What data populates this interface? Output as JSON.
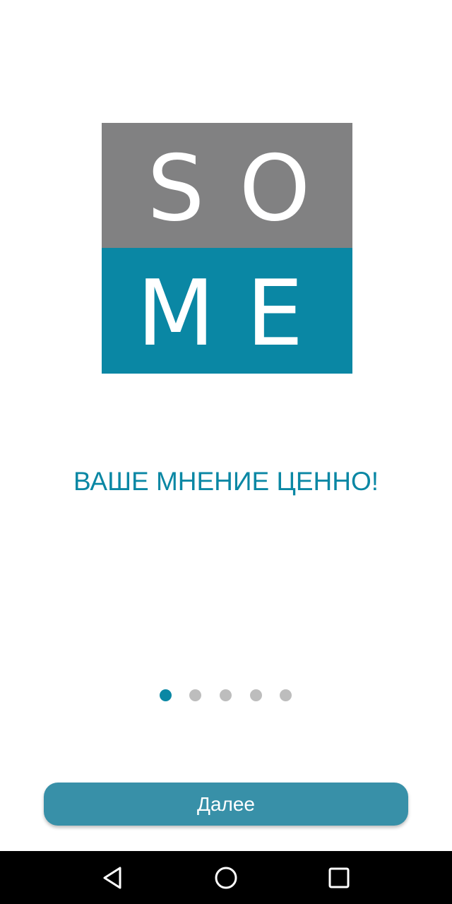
{
  "logo": {
    "letters": [
      "S",
      "O",
      "M",
      "E"
    ],
    "colors": {
      "top": "#818182",
      "bottom": "#0a87a4"
    }
  },
  "onboarding": {
    "tagline": "ВАШЕ МНЕНИЕ ЦЕННО!",
    "page_count": 5,
    "active_page": 1
  },
  "actions": {
    "next_label": "Далее"
  },
  "navbar": {
    "buttons": [
      "back-icon",
      "home-icon",
      "recents-icon"
    ]
  },
  "colors": {
    "accent": "#0a87a4",
    "button": "#3890a8",
    "dot_inactive": "#bdbdbd"
  }
}
